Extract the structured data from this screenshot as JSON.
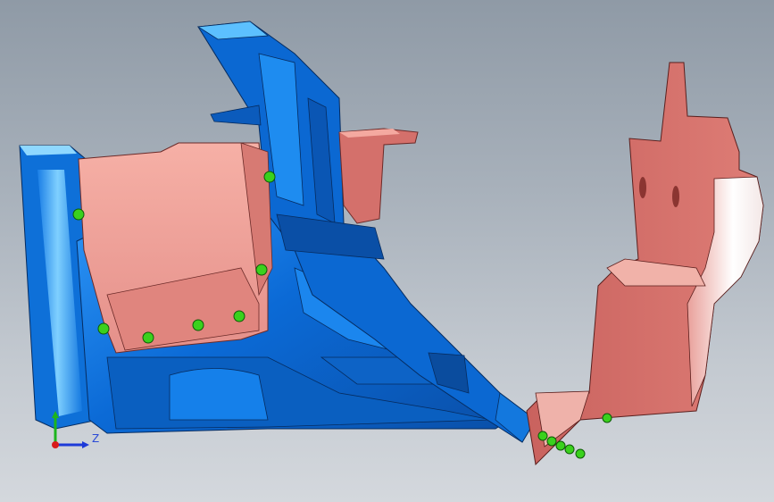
{
  "viewport": {
    "background_top": "#8f9aa6",
    "background_bottom": "#d4d8dd"
  },
  "model": {
    "blue_part_color": "#0a6fd8",
    "blue_highlight_color": "#3aa6ff",
    "pink_part_color": "#d97470",
    "pink_highlight_color": "#f4a39a",
    "weld_point_color": "#38d21b"
  },
  "triad": {
    "z_label": "Z",
    "x_axis_color": "#d81b1b",
    "y_axis_color": "#1db51d",
    "z_axis_color": "#1d3ad8"
  }
}
